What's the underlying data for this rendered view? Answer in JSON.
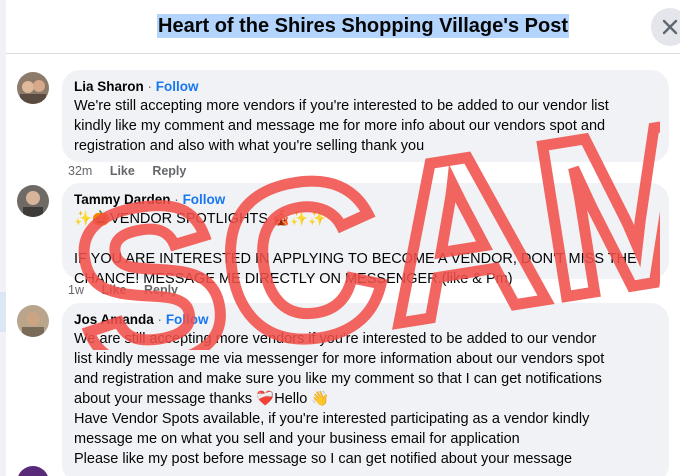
{
  "header": {
    "title": "Heart of the Shires Shopping Village's Post",
    "close_icon": "close-icon"
  },
  "comments": [
    {
      "author": "Lia Sharon",
      "separator": "·",
      "follow": "Follow",
      "body": "We're still accepting more vendors if you're interested to be added to our vendor list\nkindly like my comment and message me for more info about our vendors spot and\nregistration and also with what you're selling thank you",
      "time": "32m",
      "like": "Like",
      "reply": "Reply"
    },
    {
      "author": "Tammy Darden",
      "separator": "·",
      "follow": "Follow",
      "body": "✨🎃VENDOR SPOTLIGHTS 🎪✨✨\n\nIF YOU ARE INTERESTED IN APPLYING TO BECOME A VENDOR, DON'T MISS THE\nCHANCE! MESSAGE ME DIRECTLY ON MESSENGER.(like & Pm)",
      "time": "1w",
      "like": "Like",
      "reply": "Reply"
    },
    {
      "author": "Jos Amanda",
      "separator": "·",
      "follow": "Follow",
      "body": "We are still accepting more vendors if you're interested to be added to our vendor\nlist kindly message me via messenger for more information about our vendors spot\nand registration and make sure you like my comment so that I can get notifications\nabout your message thanks ❤️‍🩹Hello 👋\nHave Vendor Spots available, if you're interested participating as a vendor kindly\nmessage me on what you sell and your business email for application\nPlease like my post before message so I can get notified about your message"
    }
  ],
  "overlay": {
    "text": "SCAM!",
    "color": "#f0504a"
  }
}
